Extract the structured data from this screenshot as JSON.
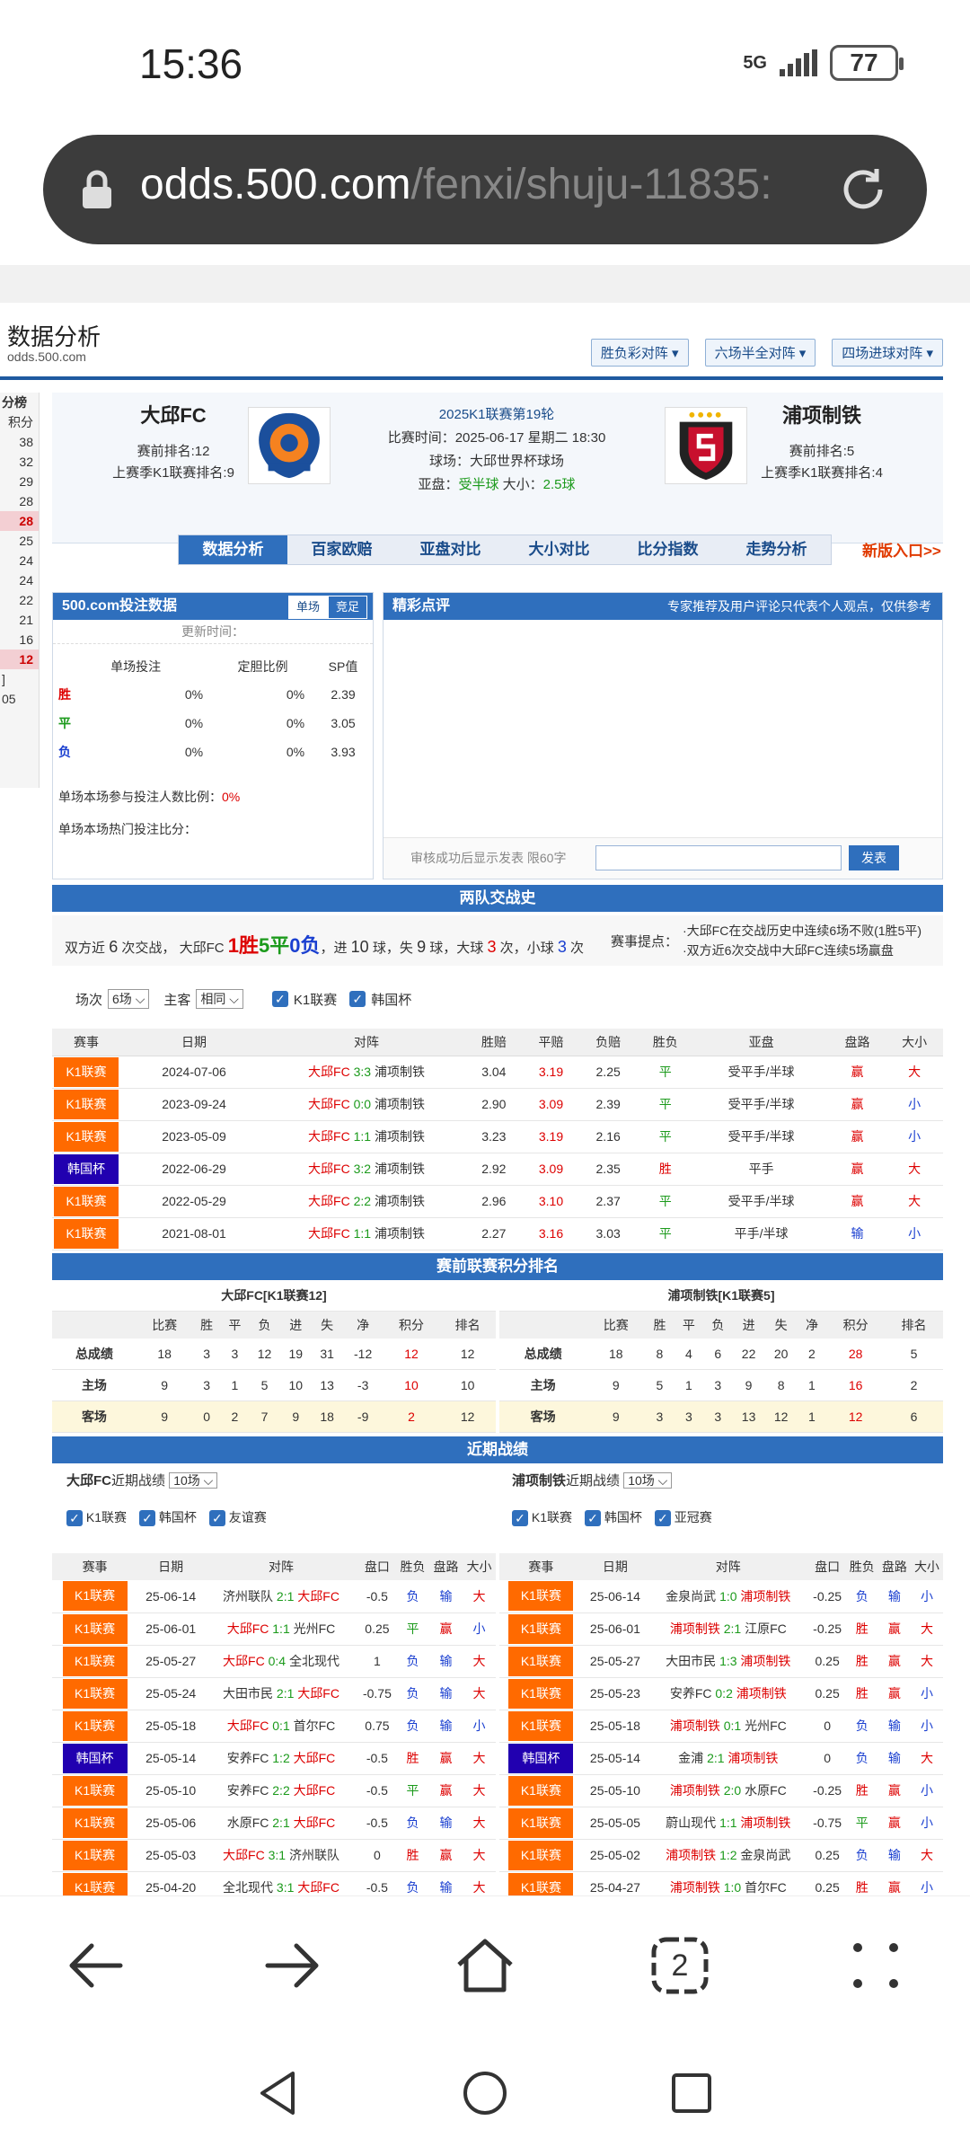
{
  "status": {
    "time": "15:36",
    "network": "5G",
    "battery": "77"
  },
  "url": {
    "host": "odds.500.com",
    "path": "/fenxi/shuju-11835:"
  },
  "header": {
    "title": "数据分析",
    "subtitle": "odds.500.com",
    "buttons": [
      "胜负彩对阵 ▾",
      "六场半全对阵 ▾",
      "四场进球对阵 ▾"
    ]
  },
  "left_strip": {
    "title": "分榜",
    "col": "积分",
    "values": [
      "38",
      "32",
      "29",
      "28",
      "28",
      "25",
      "24",
      "24",
      "22",
      "21",
      "16",
      "12"
    ],
    "foot1": "]",
    "foot2": "05"
  },
  "match": {
    "home": {
      "name": "大邱FC",
      "rank": "赛前排名:12",
      "last": "上赛季K1联赛排名:9"
    },
    "away": {
      "name": "浦项制铁",
      "rank": "赛前排名:5",
      "last": "上赛季K1联赛排名:4"
    },
    "round": "2025K1联赛第19轮",
    "time": "比赛时间：2025-06-17 星期二 18:30",
    "venue": "球场：大邱世界杯球场",
    "asia_label": "亚盘：",
    "asia": "受半球",
    "ou_label": " 大小：",
    "ou": "2.5球"
  },
  "tabs": [
    "数据分析",
    "百家欧赔",
    "亚盘对比",
    "大小对比",
    "比分指数",
    "走势分析"
  ],
  "new_version": "新版入口>>",
  "bet_panel": {
    "title": "500.com投注数据",
    "toggle": [
      "单场",
      "竞足"
    ],
    "update": "更新时间：",
    "cols": [
      "单场投注",
      "定胆比例",
      "SP值"
    ],
    "rows": [
      {
        "label": "胜",
        "bet": "0%",
        "ratio": "0%",
        "sp": "2.39"
      },
      {
        "label": "平",
        "bet": "0%",
        "ratio": "0%",
        "sp": "3.05"
      },
      {
        "label": "负",
        "bet": "0%",
        "ratio": "0%",
        "sp": "3.93"
      }
    ],
    "participation_label": "单场本场参与投注人数比例：",
    "participation": "0%",
    "hot_label": "单场本场热门投注比分："
  },
  "comment_panel": {
    "title": "精彩点评",
    "note": "专家推荐及用户评论只代表个人观点，仅供参考",
    "hint": "审核成功后显示发表 限60字",
    "submit": "发表"
  },
  "h2h": {
    "title": "两队交战史",
    "s1": "双方近",
    "n": "6",
    "s2": "次交战，",
    "team": "大邱FC",
    "win": "1胜",
    "draw": "5平",
    "lose": "0负",
    "s3": "，进",
    "goals_for": "10",
    "s4": "球，失",
    "goals_against": "9",
    "s5": "球，大球",
    "big": "3",
    "s6": "次，小球",
    "small": "3",
    "s7": "次",
    "points_label": "赛事提点：",
    "tips": [
      "·大邱FC在交战历史中连续6场不败(1胜5平)",
      "·双方近6次交战中大邱FC连续5场赢盘"
    ],
    "filter": {
      "count_label": "场次",
      "count": "6场 ⌵",
      "home_label": "主客",
      "home": "相同 ⌵",
      "chk1": "K1联赛",
      "chk2": "韩国杯"
    },
    "cols": [
      "赛事",
      "日期",
      "对阵",
      "胜赔",
      "平赔",
      "负赔",
      "胜负",
      "亚盘",
      "盘路",
      "大小"
    ],
    "rows": [
      {
        "league": "K1联赛",
        "date": "2024-07-06",
        "home": "大邱FC",
        "score": "3:3",
        "away": "浦项制铁",
        "w": "3.04",
        "d": "3.19",
        "l": "2.25",
        "res": "平",
        "asia": "受平手/半球",
        "pan": "赢",
        "ou": "大"
      },
      {
        "league": "K1联赛",
        "date": "2023-09-24",
        "home": "大邱FC",
        "score": "0:0",
        "away": "浦项制铁",
        "w": "2.90",
        "d": "3.09",
        "l": "2.39",
        "res": "平",
        "asia": "受平手/半球",
        "pan": "赢",
        "ou": "小"
      },
      {
        "league": "K1联赛",
        "date": "2023-05-09",
        "home": "大邱FC",
        "score": "1:1",
        "away": "浦项制铁",
        "w": "3.23",
        "d": "3.19",
        "l": "2.16",
        "res": "平",
        "asia": "受平手/半球",
        "pan": "赢",
        "ou": "小"
      },
      {
        "league": "韩国杯",
        "date": "2022-06-29",
        "home": "大邱FC",
        "score": "3:2",
        "away": "浦项制铁",
        "w": "2.92",
        "d": "3.09",
        "l": "2.35",
        "res": "胜",
        "asia": "平手",
        "pan": "赢",
        "ou": "大"
      },
      {
        "league": "K1联赛",
        "date": "2022-05-29",
        "home": "大邱FC",
        "score": "2:2",
        "away": "浦项制铁",
        "w": "2.96",
        "d": "3.10",
        "l": "2.37",
        "res": "平",
        "asia": "受平手/半球",
        "pan": "赢",
        "ou": "大"
      },
      {
        "league": "K1联赛",
        "date": "2021-08-01",
        "home": "大邱FC",
        "score": "1:1",
        "away": "浦项制铁",
        "w": "2.27",
        "d": "3.16",
        "l": "3.03",
        "res": "平",
        "asia": "平手/半球",
        "pan": "输",
        "ou": "小"
      }
    ]
  },
  "standings": {
    "title": "赛前联赛积分排名",
    "cols": [
      "",
      "比赛",
      "胜",
      "平",
      "负",
      "进",
      "失",
      "净",
      "积分",
      "排名"
    ],
    "home": {
      "caption": "大邱FC[K1联赛12]",
      "rows": [
        [
          "总成绩",
          "18",
          "3",
          "3",
          "12",
          "19",
          "31",
          "-12",
          "12",
          "12"
        ],
        [
          "主场",
          "9",
          "3",
          "1",
          "5",
          "10",
          "13",
          "-3",
          "10",
          "10"
        ],
        [
          "客场",
          "9",
          "0",
          "2",
          "7",
          "9",
          "18",
          "-9",
          "2",
          "12"
        ]
      ]
    },
    "away": {
      "caption": "浦项制铁[K1联赛5]",
      "rows": [
        [
          "总成绩",
          "18",
          "8",
          "4",
          "6",
          "22",
          "20",
          "2",
          "28",
          "5"
        ],
        [
          "主场",
          "9",
          "5",
          "1",
          "3",
          "9",
          "8",
          "1",
          "16",
          "2"
        ],
        [
          "客场",
          "9",
          "3",
          "3",
          "3",
          "13",
          "12",
          "1",
          "12",
          "6"
        ]
      ]
    }
  },
  "recent": {
    "title": "近期战绩",
    "cols": [
      "赛事",
      "日期",
      "对阵",
      "盘口",
      "胜负",
      "盘路",
      "大小"
    ],
    "home": {
      "team": "大邱FC",
      "label": "近期战绩",
      "count": "10场 ⌵",
      "chks": [
        "K1联赛",
        "韩国杯",
        "友谊赛"
      ],
      "rows": [
        {
          "league": "K1联赛",
          "date": "25-06-14",
          "h": "济州联队",
          "s": "2:1",
          "a": "大邱FC",
          "hc": "-0.5",
          "res": "负",
          "pan": "输",
          "ou": "大"
        },
        {
          "league": "K1联赛",
          "date": "25-06-01",
          "h": "大邱FC",
          "s": "1:1",
          "a": "光州FC",
          "hc": "0.25",
          "res": "平",
          "pan": "赢",
          "ou": "小"
        },
        {
          "league": "K1联赛",
          "date": "25-05-27",
          "h": "大邱FC",
          "s": "0:4",
          "a": "全北现代",
          "hc": "1",
          "res": "负",
          "pan": "输",
          "ou": "大"
        },
        {
          "league": "K1联赛",
          "date": "25-05-24",
          "h": "大田市民",
          "s": "2:1",
          "a": "大邱FC",
          "hc": "-0.75",
          "res": "负",
          "pan": "输",
          "ou": "大"
        },
        {
          "league": "K1联赛",
          "date": "25-05-18",
          "h": "大邱FC",
          "s": "0:1",
          "a": "首尔FC",
          "hc": "0.75",
          "res": "负",
          "pan": "输",
          "ou": "小"
        },
        {
          "league": "韩国杯",
          "date": "25-05-14",
          "h": "安养FC",
          "s": "1:2",
          "a": "大邱FC",
          "hc": "-0.5",
          "res": "胜",
          "pan": "赢",
          "ou": "大"
        },
        {
          "league": "K1联赛",
          "date": "25-05-10",
          "h": "安养FC",
          "s": "2:2",
          "a": "大邱FC",
          "hc": "-0.5",
          "res": "平",
          "pan": "赢",
          "ou": "大"
        },
        {
          "league": "K1联赛",
          "date": "25-05-06",
          "h": "水原FC",
          "s": "2:1",
          "a": "大邱FC",
          "hc": "-0.5",
          "res": "负",
          "pan": "输",
          "ou": "大"
        },
        {
          "league": "K1联赛",
          "date": "25-05-03",
          "h": "大邱FC",
          "s": "3:1",
          "a": "济州联队",
          "hc": "0",
          "res": "胜",
          "pan": "赢",
          "ou": "大"
        },
        {
          "league": "K1联赛",
          "date": "25-04-20",
          "h": "全北现代",
          "s": "3:1",
          "a": "大邱FC",
          "hc": "-0.5",
          "res": "负",
          "pan": "输",
          "ou": "大"
        }
      ]
    },
    "away": {
      "team": "浦项制铁",
      "label": "近期战绩",
      "count": "10场 ⌵",
      "chks": [
        "K1联赛",
        "韩国杯",
        "亚冠赛"
      ],
      "rows": [
        {
          "league": "K1联赛",
          "date": "25-06-14",
          "h": "金泉尚武",
          "s": "1:0",
          "a": "浦项制铁",
          "hc": "-0.25",
          "res": "负",
          "pan": "输",
          "ou": "小"
        },
        {
          "league": "K1联赛",
          "date": "25-06-01",
          "h": "浦项制铁",
          "s": "2:1",
          "a": "江原FC",
          "hc": "-0.25",
          "res": "胜",
          "pan": "赢",
          "ou": "大"
        },
        {
          "league": "K1联赛",
          "date": "25-05-27",
          "h": "大田市民",
          "s": "1:3",
          "a": "浦项制铁",
          "hc": "0.25",
          "res": "胜",
          "pan": "赢",
          "ou": "大"
        },
        {
          "league": "K1联赛",
          "date": "25-05-23",
          "h": "安养FC",
          "s": "0:2",
          "a": "浦项制铁",
          "hc": "0.25",
          "res": "胜",
          "pan": "赢",
          "ou": "小"
        },
        {
          "league": "K1联赛",
          "date": "25-05-18",
          "h": "浦项制铁",
          "s": "0:1",
          "a": "光州FC",
          "hc": "0",
          "res": "负",
          "pan": "输",
          "ou": "小"
        },
        {
          "league": "韩国杯",
          "date": "25-05-14",
          "h": "金浦",
          "s": "2:1",
          "a": "浦项制铁",
          "hc": "0",
          "res": "负",
          "pan": "输",
          "ou": "大"
        },
        {
          "league": "K1联赛",
          "date": "25-05-10",
          "h": "浦项制铁",
          "s": "2:0",
          "a": "水原FC",
          "hc": "-0.25",
          "res": "胜",
          "pan": "赢",
          "ou": "小"
        },
        {
          "league": "K1联赛",
          "date": "25-05-05",
          "h": "蔚山现代",
          "s": "1:1",
          "a": "浦项制铁",
          "hc": "-0.75",
          "res": "平",
          "pan": "赢",
          "ou": "小"
        },
        {
          "league": "K1联赛",
          "date": "25-05-02",
          "h": "浦项制铁",
          "s": "1:2",
          "a": "金泉尚武",
          "hc": "0.25",
          "res": "负",
          "pan": "输",
          "ou": "大"
        },
        {
          "league": "K1联赛",
          "date": "25-04-27",
          "h": "浦项制铁",
          "s": "1:0",
          "a": "首尔FC",
          "hc": "0.25",
          "res": "胜",
          "pan": "赢",
          "ou": "小"
        }
      ]
    }
  },
  "nav": {
    "tabs_count": "2"
  }
}
